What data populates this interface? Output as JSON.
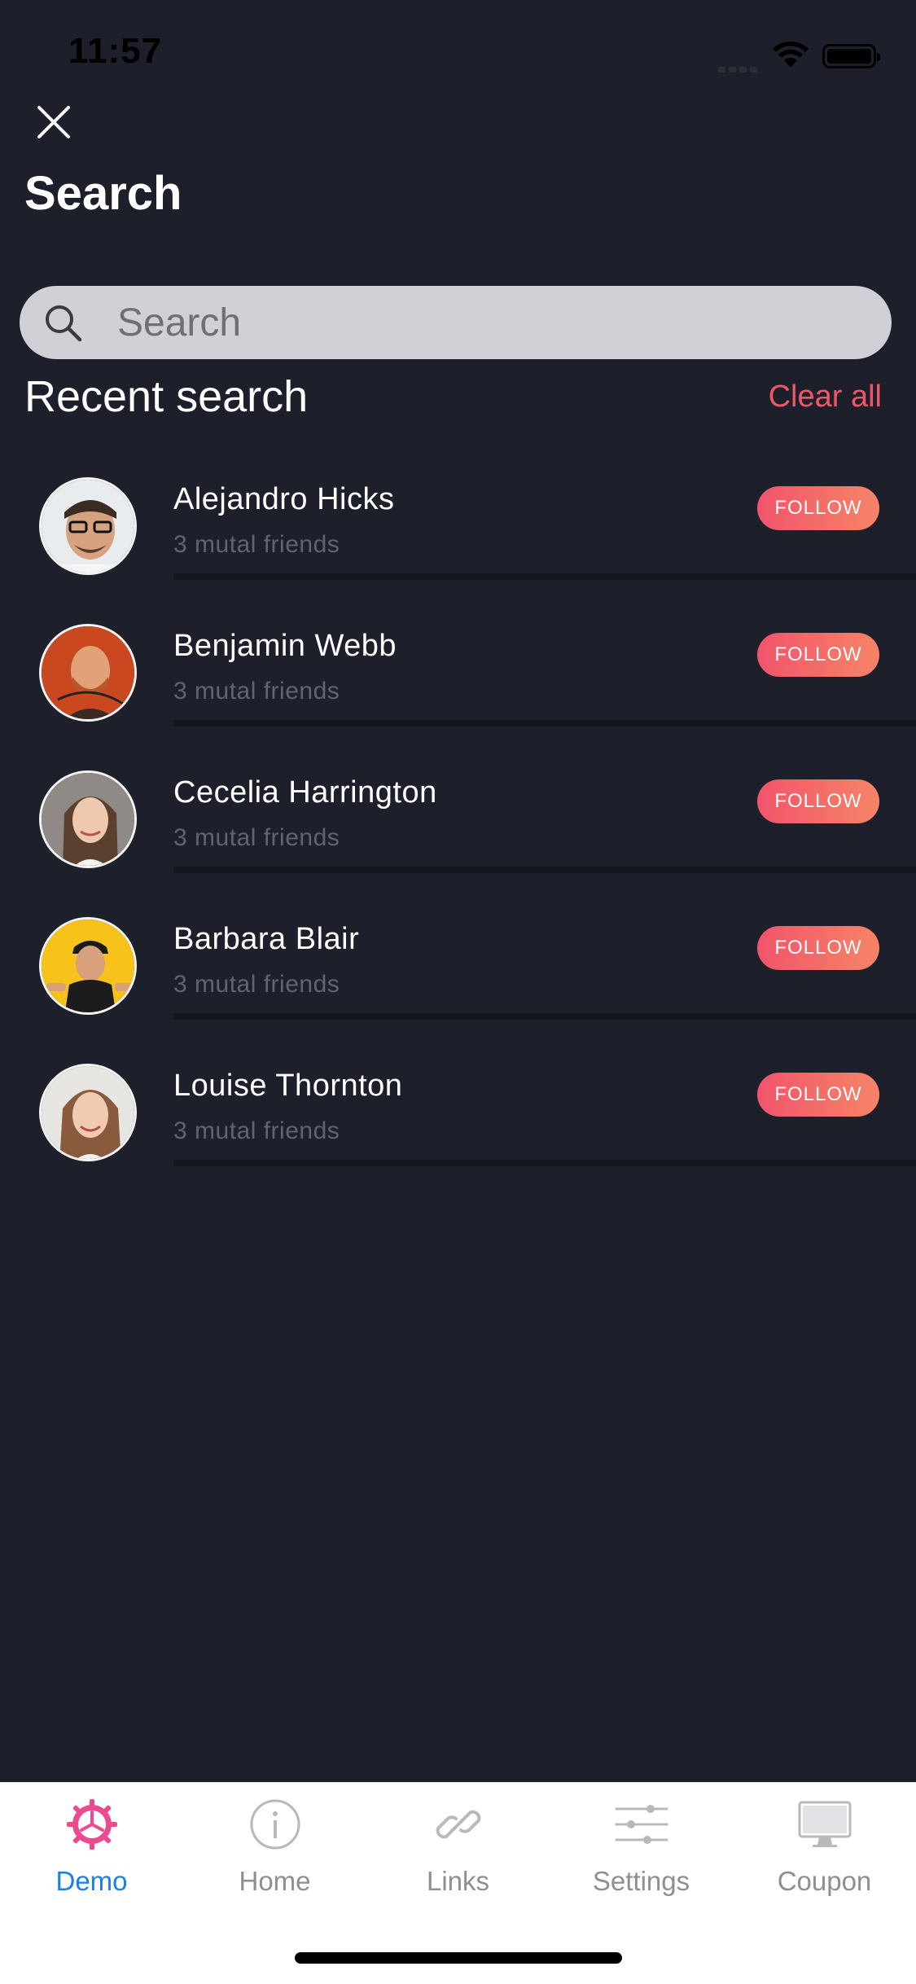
{
  "status_bar": {
    "time": "11:57"
  },
  "header": {
    "title": "Search",
    "close_icon": "close-icon"
  },
  "search": {
    "placeholder": "Search",
    "value": ""
  },
  "recent": {
    "title": "Recent search",
    "clear_label": "Clear all",
    "items": [
      {
        "name": "Alejandro Hicks",
        "subtitle": "3 mutal friends",
        "follow_label": "FOLLOW"
      },
      {
        "name": "Benjamin Webb",
        "subtitle": "3 mutal friends",
        "follow_label": "FOLLOW"
      },
      {
        "name": "Cecelia Harrington",
        "subtitle": "3 mutal friends",
        "follow_label": "FOLLOW"
      },
      {
        "name": "Barbara Blair",
        "subtitle": "3 mutal friends",
        "follow_label": "FOLLOW"
      },
      {
        "name": "Louise Thornton",
        "subtitle": "3 mutal friends",
        "follow_label": "FOLLOW"
      }
    ]
  },
  "tab_bar": {
    "tabs": [
      {
        "label": "Demo",
        "icon": "gear-icon",
        "active": true
      },
      {
        "label": "Home",
        "icon": "info-icon",
        "active": false
      },
      {
        "label": "Links",
        "icon": "link-icon",
        "active": false
      },
      {
        "label": "Settings",
        "icon": "sliders-icon",
        "active": false
      },
      {
        "label": "Coupon",
        "icon": "monitor-icon",
        "active": false
      }
    ]
  },
  "colors": {
    "background": "#1d1f2a",
    "accent": "#f0566a",
    "follow_gradient_start": "#f2546b",
    "follow_gradient_end": "#f68467",
    "active_tab": "#1a7fe6",
    "demo_icon": "#ec4a8f"
  }
}
